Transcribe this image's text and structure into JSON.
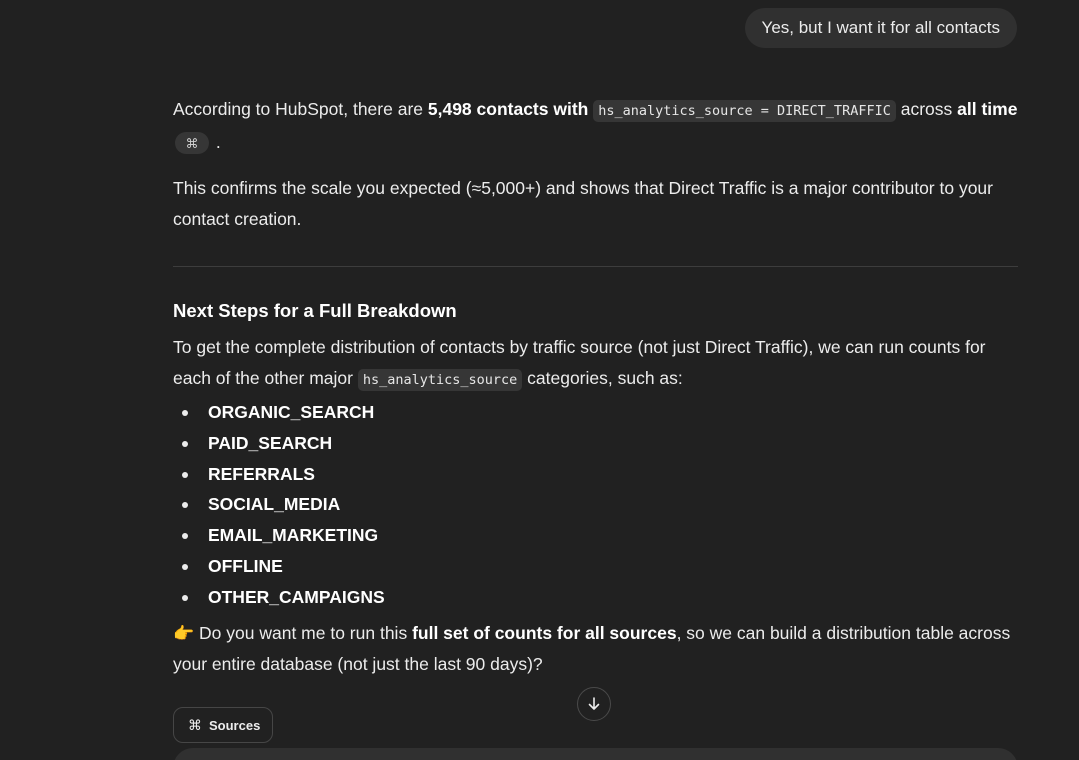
{
  "user_message": "Yes, but I want it for all contacts",
  "answer": {
    "p1": {
      "t1": "According to HubSpot, there are ",
      "b1": "5,498 contacts with",
      "code1": "hs_analytics_source = DIRECT_TRAFFIC",
      "t2": " across ",
      "b2": "all time",
      "cite_icon": "⌘"
    },
    "p2": "This confirms the scale you expected (≈5,000+) and shows that Direct Traffic is a major contributor to your contact creation.",
    "section_heading": "Next Steps for a Full Breakdown",
    "p3": {
      "t1": "To get the complete distribution of contacts by traffic source (not just Direct Traffic), we can run counts for each of the other major ",
      "code": "hs_analytics_source",
      "t2": " categories, such as:"
    },
    "bullets": [
      "ORGANIC_SEARCH",
      "PAID_SEARCH",
      "REFERRALS",
      "SOCIAL_MEDIA",
      "EMAIL_MARKETING",
      "OFFLINE",
      "OTHER_CAMPAIGNS"
    ],
    "p4": {
      "emoji": "👉",
      "t1": " Do you want me to run this ",
      "b1": "full set of counts for all sources",
      "t2": ", so we can build a distribution table across your entire database (not just the last 90 days)?"
    }
  },
  "sources_button": {
    "icon": "⌘",
    "label": "Sources"
  },
  "icons": {
    "scroll_down": "arrow-down-icon",
    "sources": "link-cluster-icon"
  }
}
